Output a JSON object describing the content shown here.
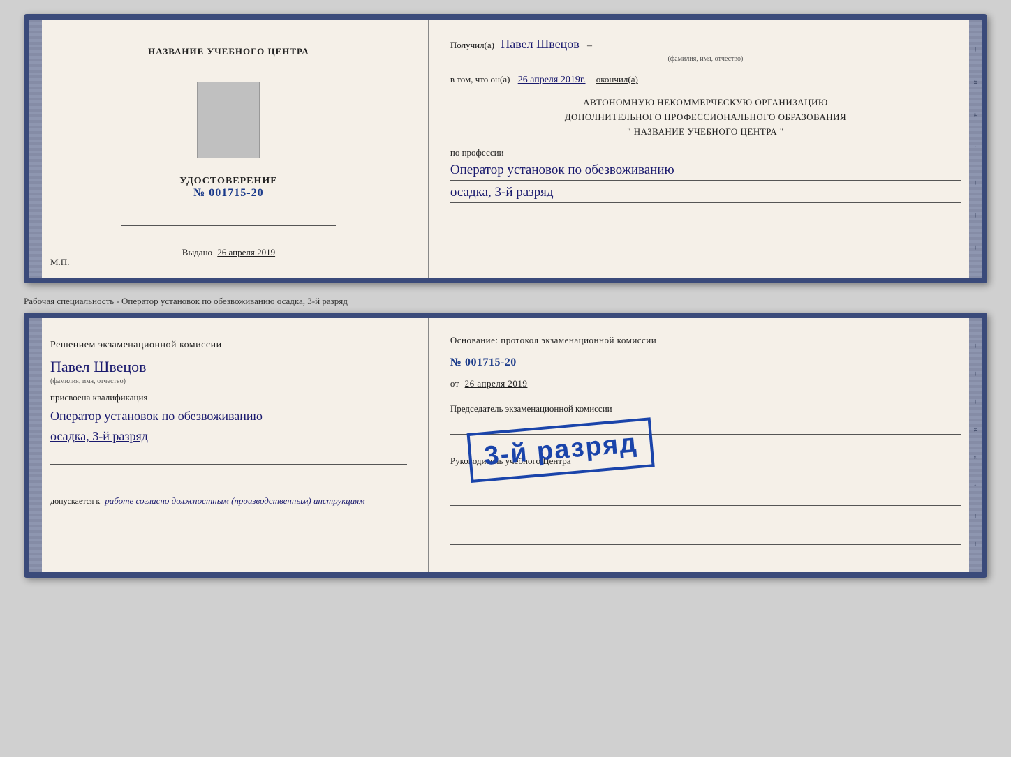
{
  "doc1": {
    "left": {
      "center_title": "НАЗВАНИЕ УЧЕБНОГО ЦЕНТРА",
      "udostoverenie_title": "УДОСТОВЕРЕНИЕ",
      "udostoverenie_number": "№ 001715-20",
      "vydano_label": "Выдано",
      "vydano_date": "26 апреля 2019",
      "mp_text": "М.П."
    },
    "right": {
      "poluchil_label": "Получил(а)",
      "poluchil_name": "Павел Швецов",
      "fio_hint": "(фамилия, имя, отчество)",
      "vtom_label": "в том, что он(а)",
      "vtom_date": "26 апреля 2019г.",
      "okonchil_label": "окончил(а)",
      "org_line1": "АВТОНОМНУЮ НЕКОММЕРЧЕСКУЮ ОРГАНИЗАЦИЮ",
      "org_line2": "ДОПОЛНИТЕЛЬНОГО ПРОФЕССИОНАЛЬНОГО ОБРАЗОВАНИЯ",
      "org_line3": "\"   НАЗВАНИЕ УЧЕБНОГО ЦЕНТРА   \"",
      "po_professii": "по профессии",
      "profession_value": "Оператор установок по обезвоживанию",
      "razryad_value": "осадка, 3-й разряд"
    }
  },
  "speciality_note": "Рабочая специальность - Оператор установок по обезвоживанию осадка, 3-й разряд",
  "doc2": {
    "left": {
      "komissia_title": "Решением  экзаменационной  комиссии",
      "person_name": "Павел Швецов",
      "fio_hint": "(фамилия, имя, отчество)",
      "prisvoena": "присвоена квалификация",
      "kvalif_line1": "Оператор установок по обезвоживанию",
      "kvalif_line2": "осадка, 3-й разряд",
      "dopuskaetsya_label": "допускается к",
      "dopuskaetsya_val": "работе согласно должностным (производственным) инструкциям"
    },
    "right": {
      "osnovanie_label": "Основание: протокол экзаменационной  комиссии",
      "protocol_number": "№  001715-20",
      "ot_label": "от",
      "ot_date": "26 апреля 2019",
      "chairman_label": "Председатель экзаменационной комиссии",
      "rukov_label": "Руководитель учебного Центра"
    },
    "stamp": {
      "text": "3-й разряд"
    }
  }
}
